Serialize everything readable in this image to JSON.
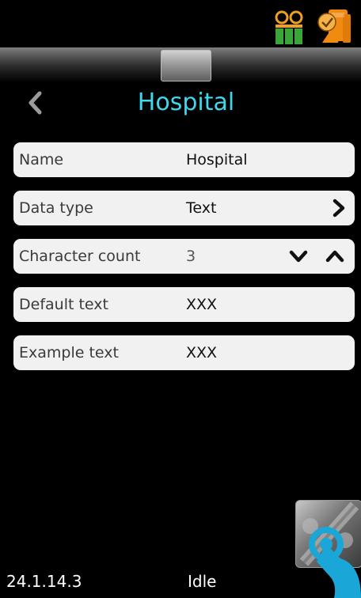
{
  "header": {
    "title": "Hospital"
  },
  "fields": [
    {
      "label": "Name",
      "value": "Hospital"
    },
    {
      "label": "Data type",
      "value": "Text"
    },
    {
      "label": "Character count",
      "value": "3"
    },
    {
      "label": "Default text",
      "value": "XXX"
    },
    {
      "label": "Example text",
      "value": "XXX"
    }
  ],
  "footer": {
    "version": "24.1.14.3",
    "status": "Idle"
  },
  "icons": {
    "tape": "tape-cassette-icon",
    "printer": "printer-status-icon",
    "back": "chevron-left-icon",
    "next": "chevron-right-icon",
    "down": "chevron-down-icon",
    "up": "chevron-up-icon",
    "gesture": "touch-gesture-icon"
  },
  "colors": {
    "accent": "#3fd7ee",
    "tape": "#f0a020",
    "battery": "#3aa63a",
    "printer": "#f08a10"
  }
}
